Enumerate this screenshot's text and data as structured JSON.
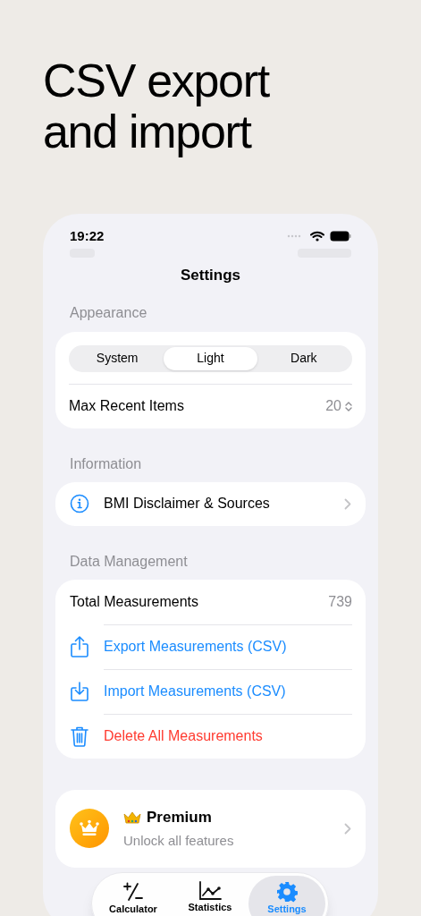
{
  "headline": "CSV export and import",
  "status_bar": {
    "time": "19:22"
  },
  "nav": {
    "title": "Settings"
  },
  "appearance": {
    "header": "Appearance",
    "theme_options": [
      {
        "label": "System",
        "selected": false
      },
      {
        "label": "Light",
        "selected": true
      },
      {
        "label": "Dark",
        "selected": false
      }
    ],
    "max_recent": {
      "label": "Max Recent Items",
      "value": "20"
    }
  },
  "information": {
    "header": "Information",
    "items": [
      {
        "label": "BMI Disclaimer & Sources"
      }
    ]
  },
  "data_management": {
    "header": "Data Management",
    "rows": [
      {
        "kind": "stat",
        "label": "Total Measurements",
        "value": "739"
      },
      {
        "kind": "export",
        "label": "Export Measurements (CSV)"
      },
      {
        "kind": "import",
        "label": "Import Measurements (CSV)"
      },
      {
        "kind": "delete",
        "label": "Delete All Measurements"
      }
    ]
  },
  "premium": {
    "title": "Premium",
    "subtitle": "Unlock all features"
  },
  "tab_bar": [
    {
      "kind": "calculator",
      "label": "Calculator",
      "selected": false
    },
    {
      "kind": "statistics",
      "label": "Statistics",
      "selected": false
    },
    {
      "kind": "settings",
      "label": "Settings",
      "selected": true
    }
  ]
}
